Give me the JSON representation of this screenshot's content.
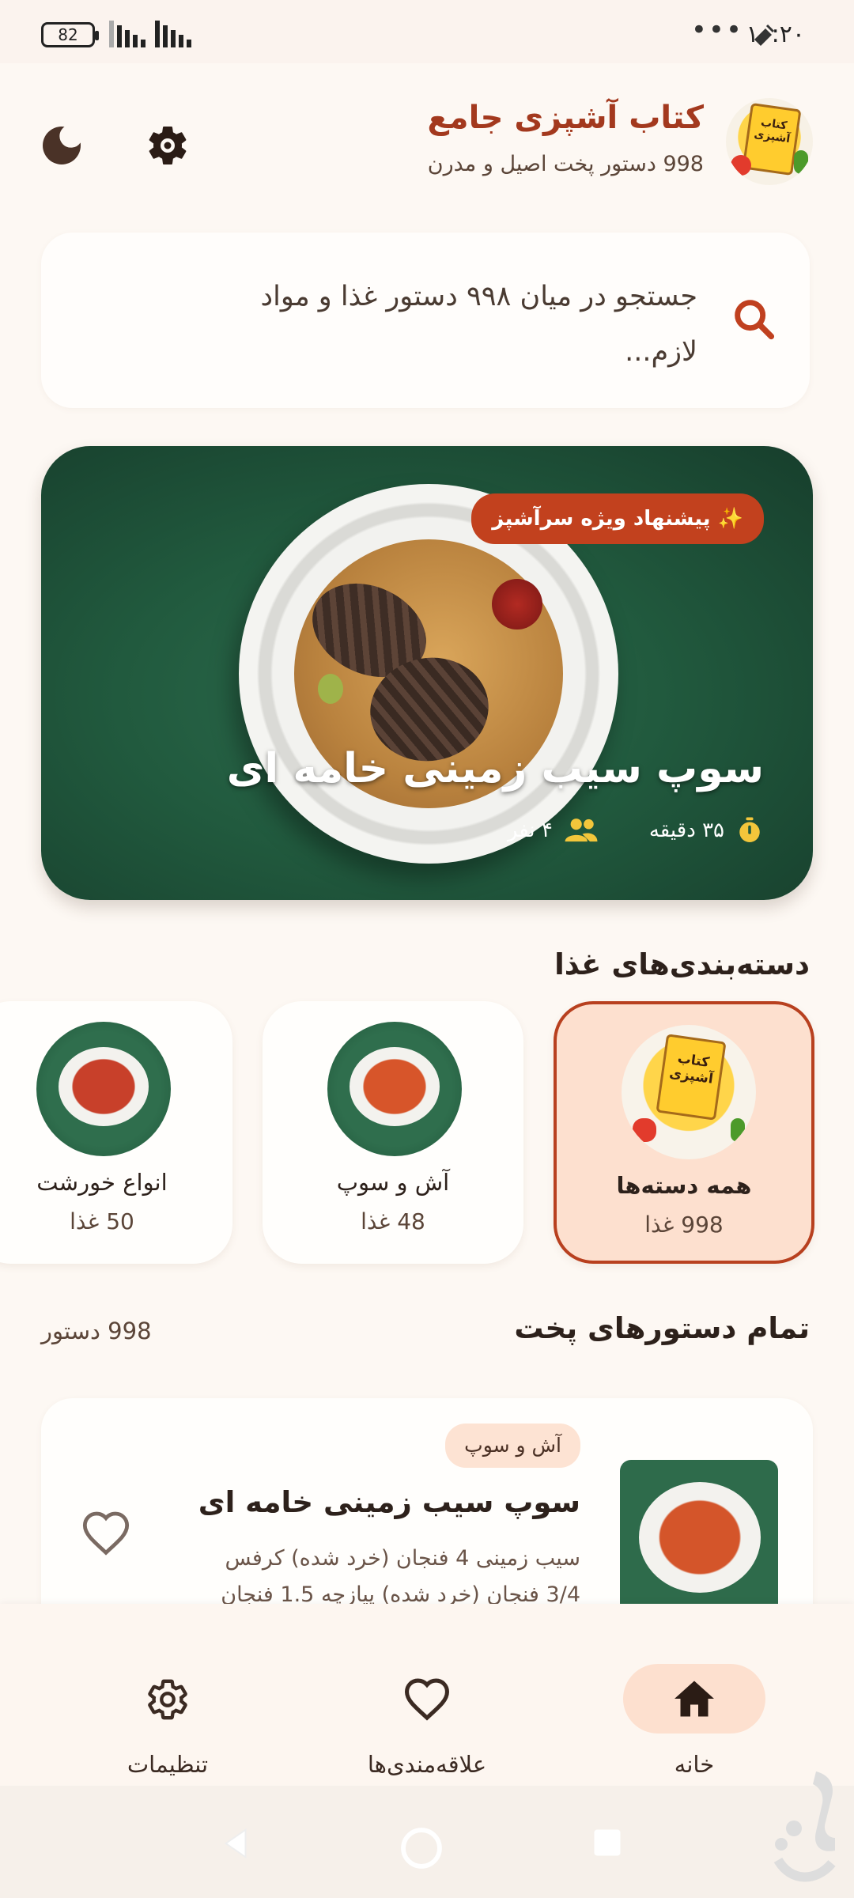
{
  "status_bar": {
    "time": "۱۰:۲۰",
    "battery": "82"
  },
  "header": {
    "title": "کتاب آشپزی جامع",
    "subtitle": "998 دستور پخت اصیل و مدرن",
    "logo_text": "کتاب آشپزی"
  },
  "search": {
    "placeholder": "جستجو در میان ۹۹۸ دستور غذا و مواد لازم..."
  },
  "hero": {
    "badge": "✨ پیشنهاد ویژه سرآشپز",
    "title": "سوپ سیب زمینی خامه ای",
    "time": "۳۵ دقیقه",
    "servings": "۴ نفر"
  },
  "categories": {
    "title": "دسته‌بندی‌های غذا",
    "items": [
      {
        "name": "همه دسته‌ها",
        "count": "998 غذا",
        "active": true
      },
      {
        "name": "آش و سوپ",
        "count": "48 غذا",
        "active": false
      },
      {
        "name": "انواع خورشت",
        "count": "50 غذا",
        "active": false
      }
    ]
  },
  "recipes": {
    "title": "تمام دستورهای پخت",
    "count": "998 دستور",
    "items": [
      {
        "tag": "آش و سوپ",
        "title": "سوپ سیب زمینی خامه ای",
        "desc": "سیب زمینی 4 فنجان (خرد شده) کرفس 3/4 فنجان (خرد شده) پیازچه 1.5 فنجان"
      }
    ]
  },
  "bottom_nav": {
    "items": [
      {
        "label": "خانه",
        "icon": "home-icon",
        "active": true
      },
      {
        "label": "علاقه‌مندی‌ها",
        "icon": "heart-icon",
        "active": false
      },
      {
        "label": "تنظیمات",
        "icon": "gear-icon",
        "active": false
      }
    ]
  },
  "colors": {
    "accent": "#b8401f",
    "title": "#a3391e",
    "active_bg": "#fde0cf",
    "hero_green": "#215a3e"
  }
}
